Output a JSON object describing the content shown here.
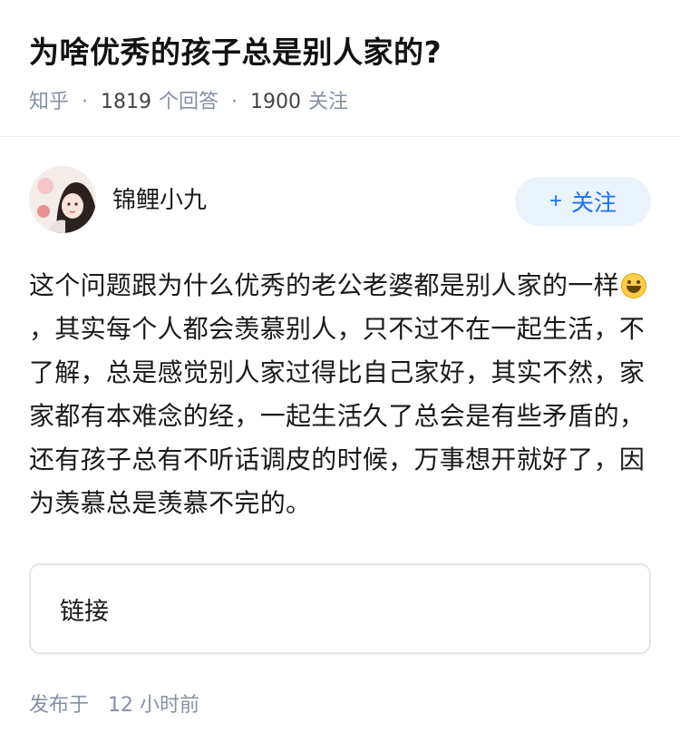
{
  "question": {
    "title": "为啥优秀的孩子总是别人家的?",
    "source": "知乎",
    "answers_count": "1819",
    "answers_label": "个回答",
    "followers_count": "1900",
    "followers_label": "关注"
  },
  "author": {
    "name": "锦鲤小九",
    "follow_plus": "+",
    "follow_label": "关注"
  },
  "answer": {
    "text_before_emoji": "这个问题跟为什么优秀的老公老婆都是别人家的一样",
    "emoji_icon": "grinning-face-emoji",
    "text_after_emoji": "，其实每个人都会羡慕别人，只不过不在一起生活，不了解，总是感觉别人家过得比自己家好，其实不然，家家都有本难念的经，一起生活久了总会是有些矛盾的，还有孩子总有不听话调皮的时候，万事想开就好了，因为羡慕总是羡慕不完的。"
  },
  "link_card": {
    "label": "链接"
  },
  "post_time": {
    "prefix": "发布于",
    "value": "12",
    "unit": "小时前"
  },
  "colors": {
    "accent": "#1772f6",
    "meta": "#8590a6",
    "follow_bg": "#eaf2fb"
  }
}
